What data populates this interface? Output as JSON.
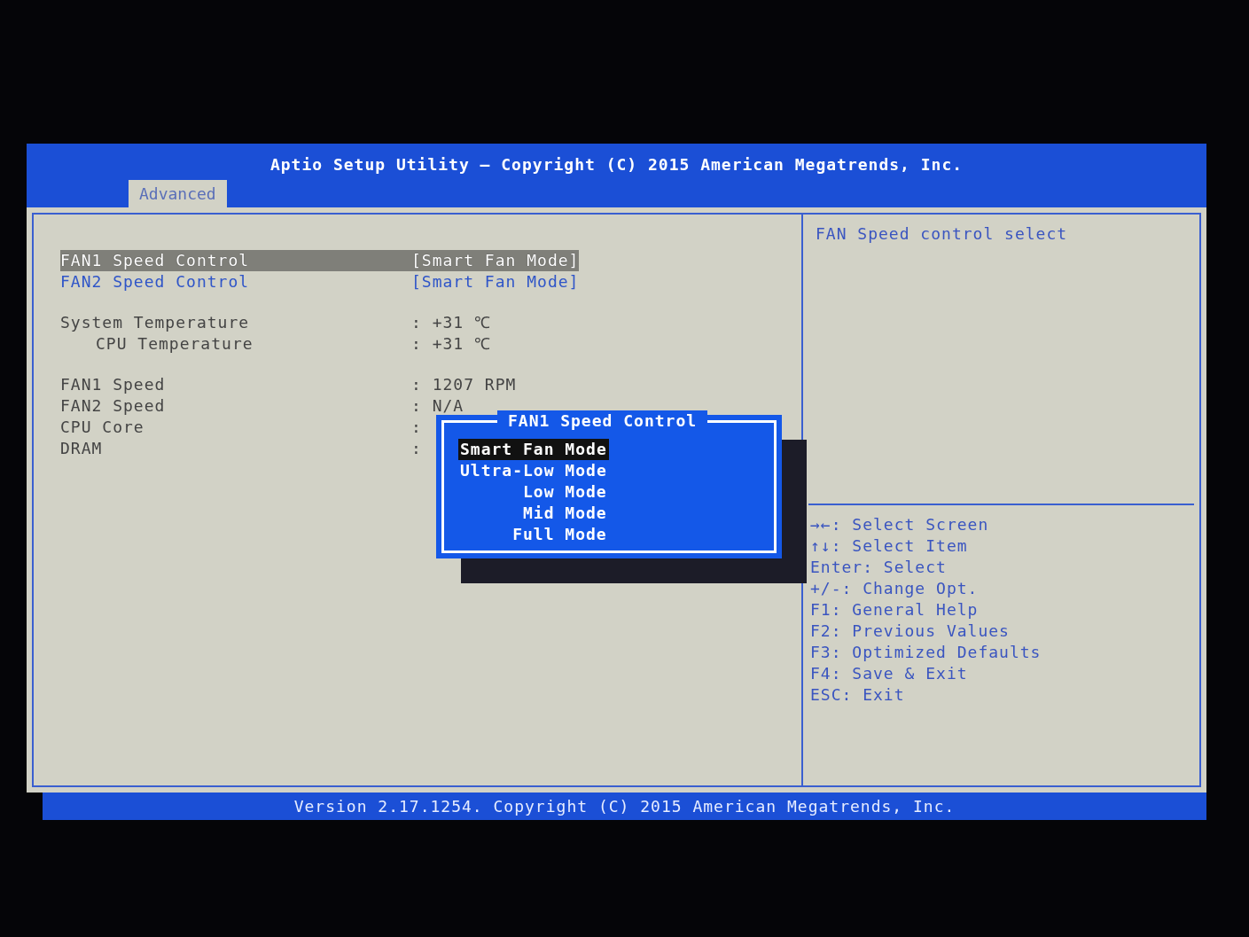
{
  "header": {
    "title": "Aptio Setup Utility – Copyright (C) 2015 American Megatrends, Inc.",
    "tabs": [
      {
        "label": "Advanced",
        "selected": true
      }
    ]
  },
  "settings": [
    {
      "label": "FAN1 Speed Control",
      "value": "[Smart Fan Mode]",
      "selected": true
    },
    {
      "label": "FAN2 Speed Control",
      "value": "[Smart Fan Mode]",
      "selected": false
    }
  ],
  "reading_groups": [
    [
      {
        "label": "System Temperature",
        "value": ": +31 ℃",
        "indented": false
      },
      {
        "label": "CPU Temperature",
        "value": ": +31 ℃",
        "indented": true
      }
    ],
    [
      {
        "label": "FAN1 Speed",
        "value": ": 1207 RPM",
        "indented": false
      },
      {
        "label": "FAN2 Speed",
        "value": ": N/A",
        "indented": false
      },
      {
        "label": "CPU Core",
        "value": ":",
        "indented": false
      },
      {
        "label": "DRAM",
        "value": ":",
        "indented": false
      }
    ]
  ],
  "popup": {
    "title": "FAN1 Speed Control",
    "options": [
      {
        "label": "Smart Fan Mode",
        "selected": true
      },
      {
        "label": "Ultra-Low Mode",
        "selected": false
      },
      {
        "label": "Low Mode",
        "selected": false
      },
      {
        "label": "Mid Mode",
        "selected": false
      },
      {
        "label": "Full Mode",
        "selected": false
      }
    ]
  },
  "help": {
    "text": "FAN Speed control select",
    "keys": [
      "→←: Select Screen",
      "↑↓: Select Item",
      "Enter: Select",
      "+/-: Change Opt.",
      "F1: General Help",
      "F2: Previous Values",
      "F3: Optimized Defaults",
      "F4: Save & Exit",
      "ESC: Exit"
    ]
  },
  "status_bar": "Version 2.17.1254. Copyright (C) 2015 American Megatrends, Inc."
}
